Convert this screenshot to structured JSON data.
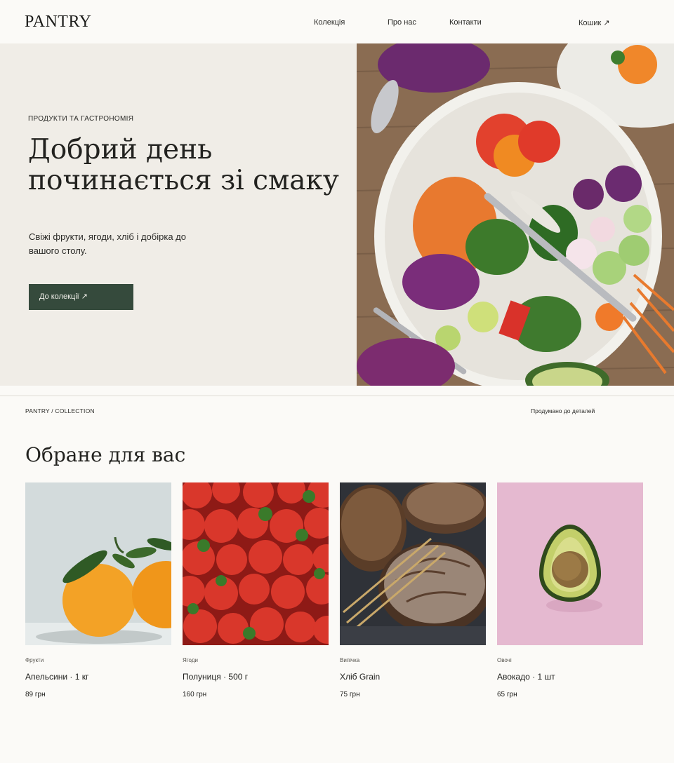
{
  "header": {
    "logo": "PANTRY",
    "nav": [
      "Колекція",
      "Про нас",
      "Контакти"
    ],
    "cart": "Кошик ↗"
  },
  "hero": {
    "eyebrow": "ПРОДУКТИ ТА ГАСТРОНОМІЯ",
    "title_line1": "Добрий день",
    "title_line2": "починається зі смаку",
    "description": "Свіжі фрукти, ягоди, хліб і добірка до вашого столу.",
    "cta": "До колекції ↗",
    "image_icon": "salad-bowl-photo"
  },
  "collection_bar": {
    "breadcrumb": "PANTRY / COLLECTION",
    "tagline": "Продумано до деталей"
  },
  "section": {
    "title": "Обране для вас"
  },
  "products": [
    {
      "category": "Фрукти",
      "name": "Апельсини · 1 кг",
      "price": "89 грн",
      "image_icon": "oranges-photo"
    },
    {
      "category": "Ягоди",
      "name": "Полуниця · 500 г",
      "price": "160 грн",
      "image_icon": "strawberries-photo"
    },
    {
      "category": "Випічка",
      "name": "Хліб Grain",
      "price": "75 грн",
      "image_icon": "bread-photo"
    },
    {
      "category": "Овочі",
      "name": "Авокадо · 1 шт",
      "price": "65 грн",
      "image_icon": "avocado-photo"
    }
  ],
  "colors": {
    "background": "#fbfaf7",
    "hero_panel": "#f0ede7",
    "cta": "#354a3c",
    "divider": "#dedbd3"
  }
}
